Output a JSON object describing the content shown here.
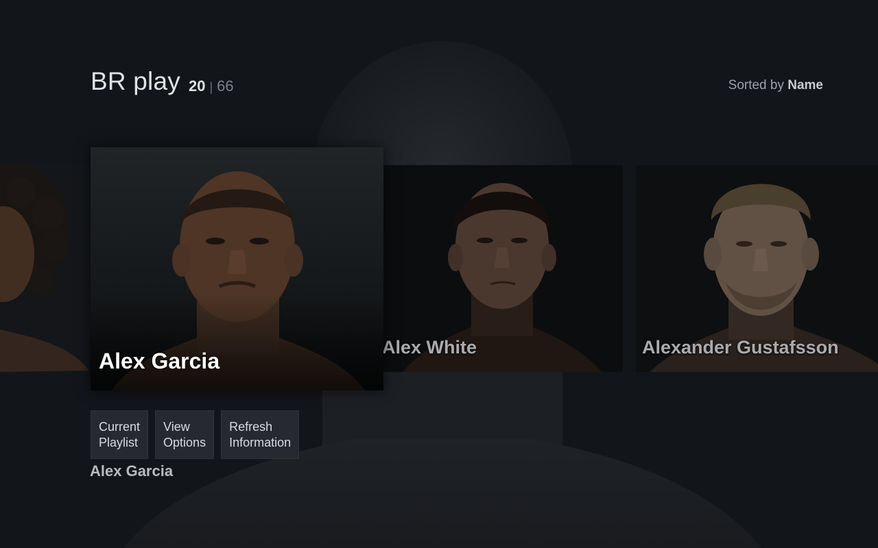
{
  "header": {
    "title": "BR play",
    "current_index": "20",
    "separator": "|",
    "total_count": "66",
    "sort_prefix": "Sorted by",
    "sort_value": "Name"
  },
  "carousel": {
    "items": [
      {
        "name": "",
        "partial": true
      },
      {
        "name": "Alex Garcia",
        "focused": true
      },
      {
        "name": "Alex White"
      },
      {
        "name": "Alexander Gustafsson"
      }
    ]
  },
  "actions": [
    {
      "line1": "Current",
      "line2": "Playlist"
    },
    {
      "line1": "View",
      "line2": "Options"
    },
    {
      "line1": "Refresh",
      "line2": "Information"
    }
  ],
  "footer": {
    "selected_name": "Alex Garcia"
  },
  "colors": {
    "background": "#12151a",
    "button": "#262a30",
    "focused_text": "#ffffff",
    "dim_text": "#a9abaf"
  }
}
